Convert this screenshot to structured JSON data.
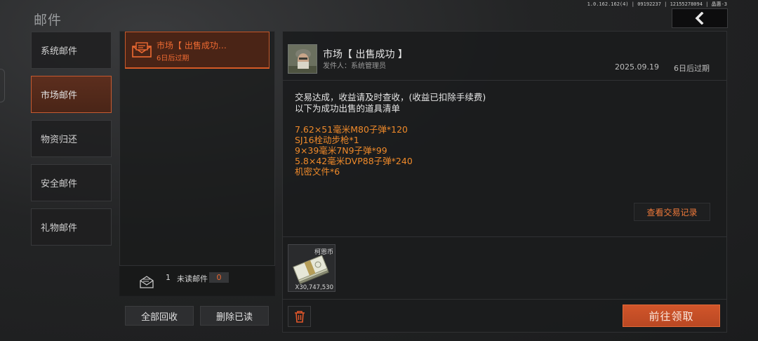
{
  "header": {
    "title": "邮件",
    "version": "1.0.162.162(4) | 09192237 | 12155278094 | 晶惠-3",
    "back_icon": "chevron-left-icon"
  },
  "categories": [
    {
      "label": "系统邮件",
      "active": false
    },
    {
      "label": "市场邮件",
      "active": true
    },
    {
      "label": "物资归还",
      "active": false
    },
    {
      "label": "安全邮件",
      "active": false
    },
    {
      "label": "礼物邮件",
      "active": false
    }
  ],
  "mail_list": {
    "items": [
      {
        "subject": "市场【 出售成功…",
        "expiry": "6日后过期",
        "icon": "envelope-icon"
      }
    ],
    "unread": {
      "count": "1",
      "label": "未读邮件",
      "badge": "0"
    },
    "buttons": {
      "collect_all": "全部回收",
      "delete_read": "删除已读"
    }
  },
  "detail": {
    "title": "市场【 出售成功 】",
    "sender": "发件人：系统管理员",
    "date": "2025.09.19",
    "expiry": "6日后过期",
    "body_lines": [
      "交易达成，收益请及时查收，(收益已扣除手续费)",
      "以下为成功出售的道具清单"
    ],
    "items_sold": [
      "7.62×51毫米M80子弹*120",
      "SJ16栓动步枪*1",
      "9×39毫米7N9子弹*99",
      "5.8×42毫米DVP88子弹*240",
      "机密文件*6"
    ],
    "trade_log_button": "查看交易记录",
    "attachment": {
      "name": "柯恩币",
      "quantity": "X30,747,530"
    },
    "claim_button": "前往领取",
    "delete_icon": "trash-icon"
  },
  "colors": {
    "accent": "#d1552a",
    "accent_text": "#ee6a32",
    "item_text": "#f08a2a"
  }
}
